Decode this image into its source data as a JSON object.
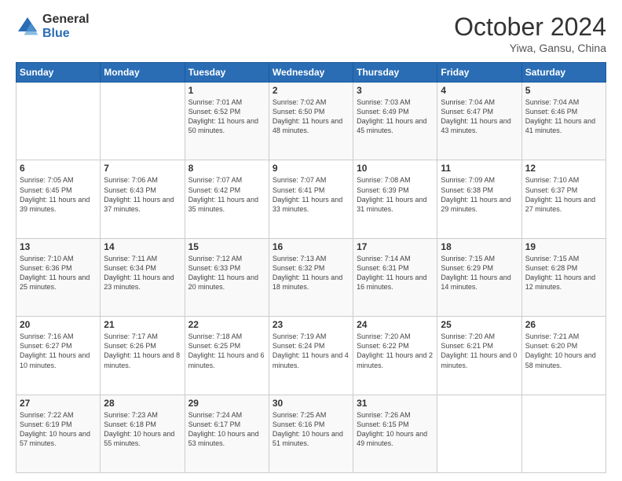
{
  "header": {
    "logo_general": "General",
    "logo_blue": "Blue",
    "month_title": "October 2024",
    "location": "Yiwa, Gansu, China"
  },
  "weekdays": [
    "Sunday",
    "Monday",
    "Tuesday",
    "Wednesday",
    "Thursday",
    "Friday",
    "Saturday"
  ],
  "weeks": [
    [
      null,
      null,
      {
        "day": "1",
        "sunrise": "7:01 AM",
        "sunset": "6:52 PM",
        "daylight": "11 hours and 50 minutes."
      },
      {
        "day": "2",
        "sunrise": "7:02 AM",
        "sunset": "6:50 PM",
        "daylight": "11 hours and 48 minutes."
      },
      {
        "day": "3",
        "sunrise": "7:03 AM",
        "sunset": "6:49 PM",
        "daylight": "11 hours and 45 minutes."
      },
      {
        "day": "4",
        "sunrise": "7:04 AM",
        "sunset": "6:47 PM",
        "daylight": "11 hours and 43 minutes."
      },
      {
        "day": "5",
        "sunrise": "7:04 AM",
        "sunset": "6:46 PM",
        "daylight": "11 hours and 41 minutes."
      }
    ],
    [
      {
        "day": "6",
        "sunrise": "7:05 AM",
        "sunset": "6:45 PM",
        "daylight": "11 hours and 39 minutes."
      },
      {
        "day": "7",
        "sunrise": "7:06 AM",
        "sunset": "6:43 PM",
        "daylight": "11 hours and 37 minutes."
      },
      {
        "day": "8",
        "sunrise": "7:07 AM",
        "sunset": "6:42 PM",
        "daylight": "11 hours and 35 minutes."
      },
      {
        "day": "9",
        "sunrise": "7:07 AM",
        "sunset": "6:41 PM",
        "daylight": "11 hours and 33 minutes."
      },
      {
        "day": "10",
        "sunrise": "7:08 AM",
        "sunset": "6:39 PM",
        "daylight": "11 hours and 31 minutes."
      },
      {
        "day": "11",
        "sunrise": "7:09 AM",
        "sunset": "6:38 PM",
        "daylight": "11 hours and 29 minutes."
      },
      {
        "day": "12",
        "sunrise": "7:10 AM",
        "sunset": "6:37 PM",
        "daylight": "11 hours and 27 minutes."
      }
    ],
    [
      {
        "day": "13",
        "sunrise": "7:10 AM",
        "sunset": "6:36 PM",
        "daylight": "11 hours and 25 minutes."
      },
      {
        "day": "14",
        "sunrise": "7:11 AM",
        "sunset": "6:34 PM",
        "daylight": "11 hours and 23 minutes."
      },
      {
        "day": "15",
        "sunrise": "7:12 AM",
        "sunset": "6:33 PM",
        "daylight": "11 hours and 20 minutes."
      },
      {
        "day": "16",
        "sunrise": "7:13 AM",
        "sunset": "6:32 PM",
        "daylight": "11 hours and 18 minutes."
      },
      {
        "day": "17",
        "sunrise": "7:14 AM",
        "sunset": "6:31 PM",
        "daylight": "11 hours and 16 minutes."
      },
      {
        "day": "18",
        "sunrise": "7:15 AM",
        "sunset": "6:29 PM",
        "daylight": "11 hours and 14 minutes."
      },
      {
        "day": "19",
        "sunrise": "7:15 AM",
        "sunset": "6:28 PM",
        "daylight": "11 hours and 12 minutes."
      }
    ],
    [
      {
        "day": "20",
        "sunrise": "7:16 AM",
        "sunset": "6:27 PM",
        "daylight": "11 hours and 10 minutes."
      },
      {
        "day": "21",
        "sunrise": "7:17 AM",
        "sunset": "6:26 PM",
        "daylight": "11 hours and 8 minutes."
      },
      {
        "day": "22",
        "sunrise": "7:18 AM",
        "sunset": "6:25 PM",
        "daylight": "11 hours and 6 minutes."
      },
      {
        "day": "23",
        "sunrise": "7:19 AM",
        "sunset": "6:24 PM",
        "daylight": "11 hours and 4 minutes."
      },
      {
        "day": "24",
        "sunrise": "7:20 AM",
        "sunset": "6:22 PM",
        "daylight": "11 hours and 2 minutes."
      },
      {
        "day": "25",
        "sunrise": "7:20 AM",
        "sunset": "6:21 PM",
        "daylight": "11 hours and 0 minutes."
      },
      {
        "day": "26",
        "sunrise": "7:21 AM",
        "sunset": "6:20 PM",
        "daylight": "10 hours and 58 minutes."
      }
    ],
    [
      {
        "day": "27",
        "sunrise": "7:22 AM",
        "sunset": "6:19 PM",
        "daylight": "10 hours and 57 minutes."
      },
      {
        "day": "28",
        "sunrise": "7:23 AM",
        "sunset": "6:18 PM",
        "daylight": "10 hours and 55 minutes."
      },
      {
        "day": "29",
        "sunrise": "7:24 AM",
        "sunset": "6:17 PM",
        "daylight": "10 hours and 53 minutes."
      },
      {
        "day": "30",
        "sunrise": "7:25 AM",
        "sunset": "6:16 PM",
        "daylight": "10 hours and 51 minutes."
      },
      {
        "day": "31",
        "sunrise": "7:26 AM",
        "sunset": "6:15 PM",
        "daylight": "10 hours and 49 minutes."
      },
      null,
      null
    ]
  ]
}
